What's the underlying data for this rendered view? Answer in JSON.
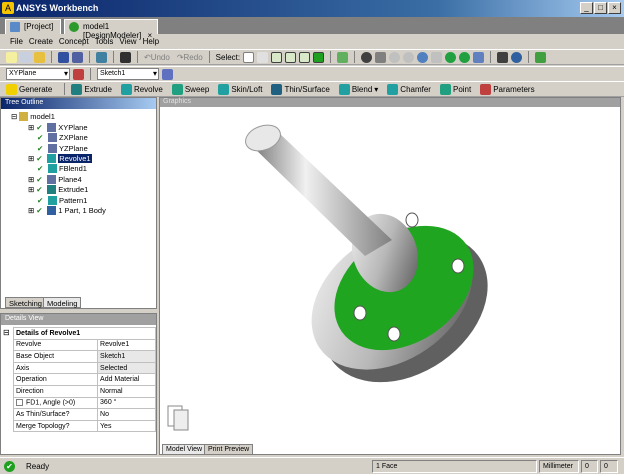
{
  "window": {
    "title": "ANSYS Workbench",
    "min": "_",
    "max": "□",
    "close": "×"
  },
  "doc_tabs": [
    {
      "label": "[Project]"
    },
    {
      "label": "model1 [DesignModeler]",
      "close": "×"
    }
  ],
  "menu": [
    "File",
    "Create",
    "Concept",
    "Tools",
    "View",
    "Help"
  ],
  "toolbar": {
    "undo": "Undo",
    "redo": "Redo",
    "select": "Select:"
  },
  "plane_combo": "XYPlane",
  "sketch_combo": "Sketch1",
  "features": [
    "Generate",
    "Extrude",
    "Revolve",
    "Sweep",
    "Skin/Loft",
    "Thin/Surface",
    "Blend",
    "Chamfer",
    "Point",
    "Parameters"
  ],
  "tree": {
    "header": "Tree Outline",
    "items": [
      "model1",
      "XYPlane",
      "ZXPlane",
      "YZPlane",
      "Revolve1",
      "FBlend1",
      "Plane4",
      "Extrude1",
      "Pattern1",
      "1 Part, 1 Body"
    ],
    "tabs": [
      "Sketching",
      "Modeling"
    ]
  },
  "details": {
    "header": "Details View",
    "title": "Details of Revolve1",
    "rows": [
      [
        "Revolve",
        "Revolve1"
      ],
      [
        "Base Object",
        "Sketch1"
      ],
      [
        "Axis",
        "Selected"
      ],
      [
        "Operation",
        "Add Material"
      ],
      [
        "Direction",
        "Normal"
      ],
      [
        "FD1, Angle (>0)",
        "360 °"
      ],
      [
        "As Thin/Surface?",
        "No"
      ],
      [
        "Merge Topology?",
        "Yes"
      ]
    ]
  },
  "graphics": {
    "header": "Graphics",
    "tabs": [
      "Model View",
      "Print Preview"
    ],
    "face_color": "#1fa51f"
  },
  "status": {
    "text": "Ready",
    "selection": "1 Face",
    "units": "Millimeter",
    "v1": "0",
    "v2": "0"
  }
}
